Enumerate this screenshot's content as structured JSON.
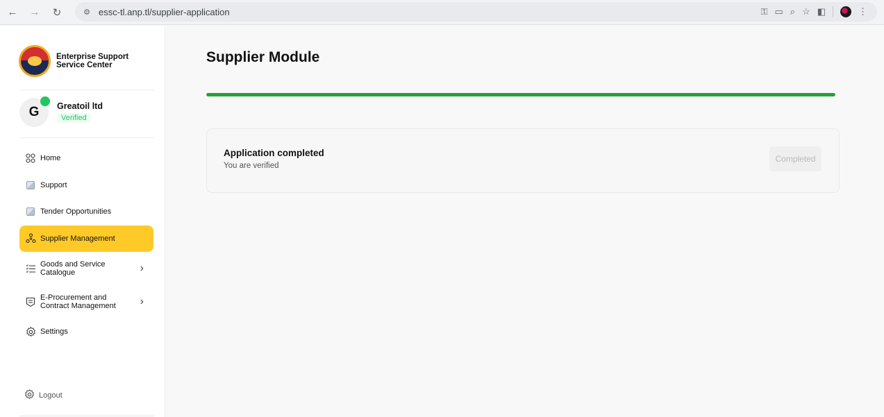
{
  "browser": {
    "url": "essc-tl.anp.tl/supplier-application"
  },
  "sidebar": {
    "brand_name": "Enterprise Support Service Center",
    "user": {
      "initial": "G",
      "name": "Greatoil ltd",
      "status": "Verified"
    },
    "items": [
      {
        "label": "Home",
        "icon": "grid-icon"
      },
      {
        "label": "Support",
        "icon": "broken-image-icon"
      },
      {
        "label": "Tender Opportunities",
        "icon": "broken-image-icon"
      },
      {
        "label": "Supplier Management",
        "icon": "network-icon",
        "active": true
      },
      {
        "label": "Goods and Service Catalogue",
        "icon": "list-icon"
      },
      {
        "label": "E-Procurement and Contract Management",
        "icon": "document-icon"
      },
      {
        "label": "Settings",
        "icon": "gear-icon"
      }
    ],
    "logout_label": "Logout"
  },
  "main": {
    "title": "Supplier Module",
    "progress_percent": 100,
    "card": {
      "title": "Application completed",
      "subtitle": "You are verified",
      "button_label": "Completed"
    }
  },
  "colors": {
    "accent": "#ffca28",
    "progress": "#27a03a",
    "verified": "#22c55e"
  }
}
